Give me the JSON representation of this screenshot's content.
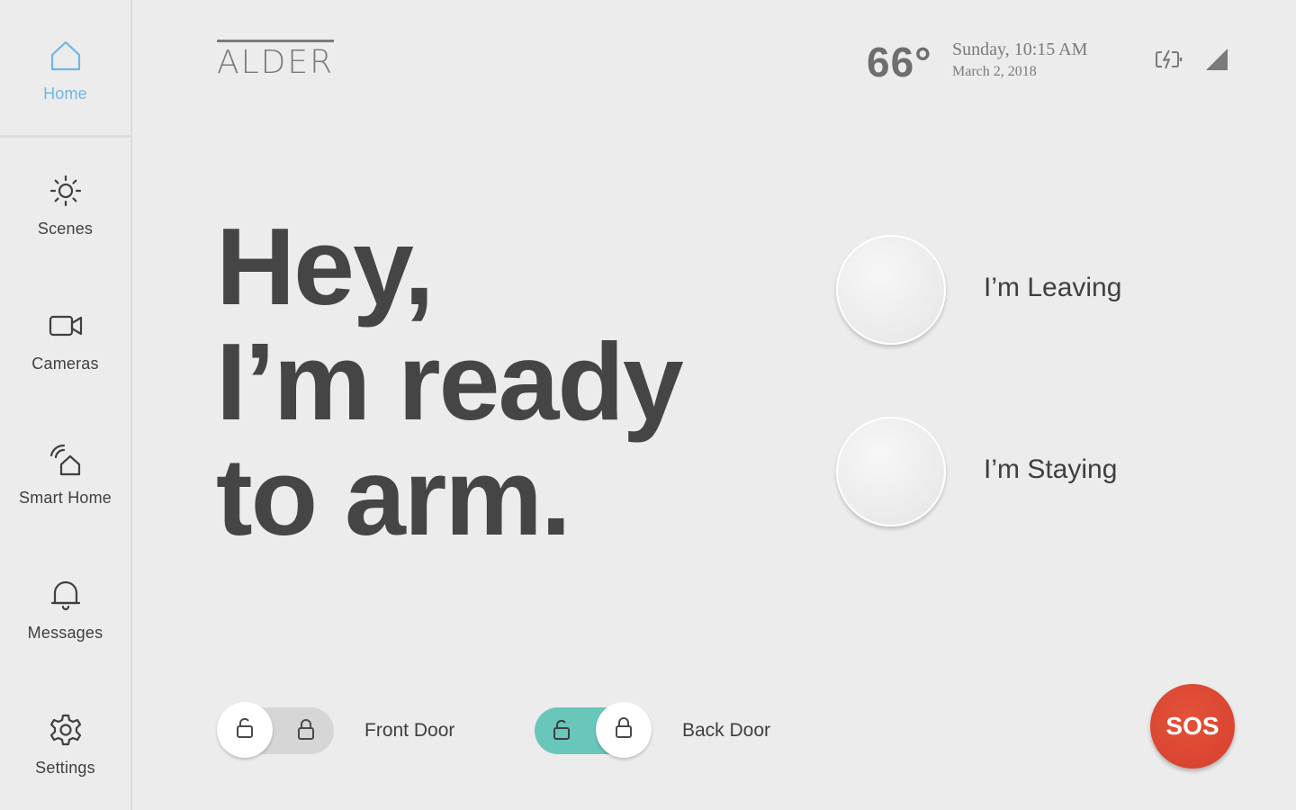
{
  "brand": {
    "name": "ALDER"
  },
  "status": {
    "temperature": "66°",
    "time_line": "Sunday, 10:15 AM",
    "date_line": "March 2, 2018",
    "battery_icon": "battery-charging-icon",
    "signal_icon": "cell-signal-icon"
  },
  "sidebar": {
    "items": [
      {
        "label": "Home",
        "icon": "home-icon",
        "active": true
      },
      {
        "label": "Scenes",
        "icon": "sun-icon",
        "active": false
      },
      {
        "label": "Cameras",
        "icon": "video-camera-icon",
        "active": false
      },
      {
        "label": "Smart Home",
        "icon": "smart-home-icon",
        "active": false
      },
      {
        "label": "Messages",
        "icon": "bell-icon",
        "active": false
      },
      {
        "label": "Settings",
        "icon": "gear-icon",
        "active": false
      }
    ]
  },
  "headline": {
    "lines": [
      "Hey,",
      "I’m ready",
      "to arm."
    ]
  },
  "arm_options": [
    {
      "label": "I’m Leaving"
    },
    {
      "label": "I’m Staying"
    }
  ],
  "doors": [
    {
      "label": "Front Door",
      "state": "unlocked",
      "icon_unlocked": "unlock-icon",
      "icon_locked": "lock-icon"
    },
    {
      "label": "Back Door",
      "state": "locked",
      "icon_unlocked": "unlock-icon",
      "icon_locked": "lock-icon"
    }
  ],
  "sos": {
    "label": "SOS"
  },
  "colors": {
    "background": "#ececec",
    "active_nav": "#6fb6e6",
    "locked_track": "#68c6bb",
    "sos": "#d84430",
    "headline": "#454545"
  }
}
